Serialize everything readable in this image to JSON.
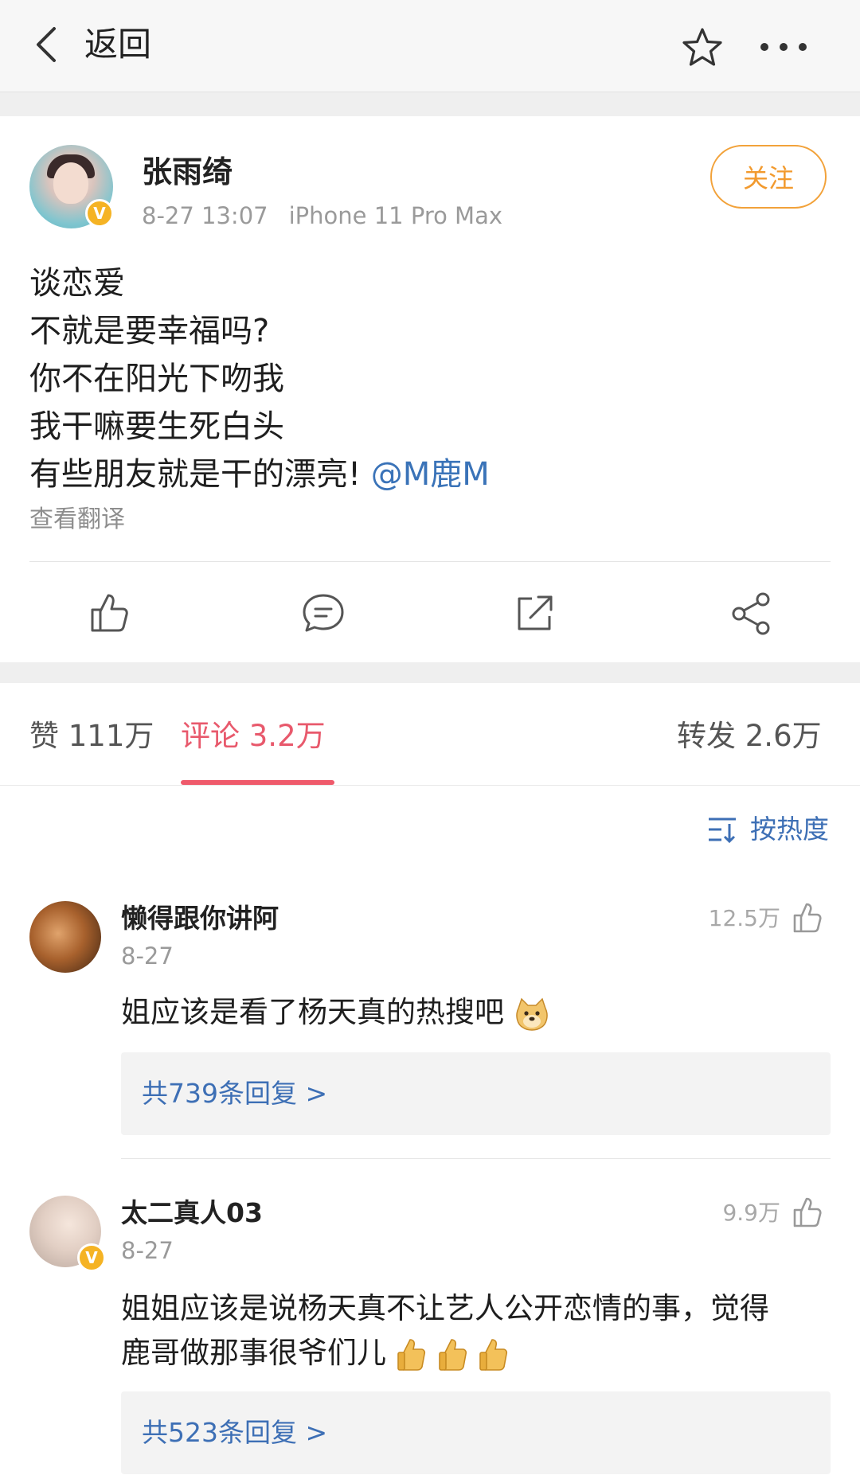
{
  "header": {
    "back_label": "返回",
    "icons": {
      "back": "chevron-left-icon",
      "favorite": "star-icon",
      "more": "more-dots-icon"
    }
  },
  "post": {
    "author": "张雨绮",
    "verified": true,
    "date": "8-27 13:07",
    "device": "iPhone 11 Pro Max",
    "follow_label": "关注",
    "lines": [
      "谈恋爱",
      "不就是要幸福吗?",
      "你不在阳光下吻我",
      "我干嘛要生死白头",
      "有些朋友就是干的漂亮!"
    ],
    "mention": "@M鹿M",
    "translate_label": "查看翻译",
    "actions": [
      "thumbs-up-icon",
      "comment-icon",
      "repost-icon",
      "share-icon"
    ]
  },
  "tabs": {
    "likes": "赞 111万",
    "comments": "评论 3.2万",
    "reposts": "转发 2.6万",
    "active": "comments"
  },
  "sort": {
    "label": "按热度"
  },
  "comments": [
    {
      "name": "懒得跟你讲阿",
      "date": "8-27",
      "likes": "12.5万",
      "text_lines": [
        "姐应该是看了杨天真的热搜吧"
      ],
      "emoji": "doge-emoji",
      "replies": "共739条回复 >"
    },
    {
      "name": "太二真人03",
      "verified": true,
      "date": "8-27",
      "likes": "9.9万",
      "text_lines": [
        "姐姐应该是说杨天真不让艺人公开恋情的事，觉得",
        "鹿哥做那事很爷们儿"
      ],
      "emoji": "thumbs-up-emoji",
      "replies": "共523条回复 >"
    }
  ],
  "colors": {
    "accent": "#e8596c",
    "link": "#3d6fb5",
    "follow": "#f29a2e",
    "verified": "#f5b324"
  }
}
